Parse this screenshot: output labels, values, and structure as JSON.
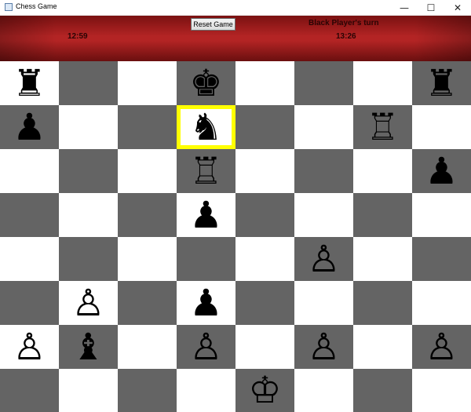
{
  "window": {
    "title": "Chess Game",
    "controls": {
      "minimize": "—",
      "maximize": "☐",
      "close": "✕"
    }
  },
  "header": {
    "reset_label": "Reset Game",
    "white_timer": "12:59",
    "black_timer": "13:26",
    "turn_text": "Black Player's turn"
  },
  "board": {
    "selected": {
      "row": 1,
      "col": 3
    },
    "highlight_color": "#ffff00",
    "light_color": "#ffffff",
    "dark_color": "#646464",
    "pieces": [
      [
        "black-rook",
        "",
        "",
        "black-king",
        "",
        "",
        "",
        "black-rook"
      ],
      [
        "black-pawn",
        "",
        "",
        "black-knight",
        "",
        "",
        "white-rook",
        ""
      ],
      [
        "",
        "",
        "",
        "white-rook",
        "",
        "",
        "",
        "black-pawn"
      ],
      [
        "",
        "",
        "",
        "black-pawn",
        "",
        "",
        "",
        ""
      ],
      [
        "",
        "",
        "",
        "",
        "",
        "white-pawn",
        "",
        ""
      ],
      [
        "",
        "white-pawn",
        "",
        "black-pawn",
        "",
        "",
        "",
        ""
      ],
      [
        "white-pawn",
        "black-bishop",
        "",
        "white-pawn",
        "",
        "white-pawn",
        "",
        "white-pawn"
      ],
      [
        "",
        "",
        "",
        "",
        "white-king",
        "",
        "",
        ""
      ]
    ]
  }
}
